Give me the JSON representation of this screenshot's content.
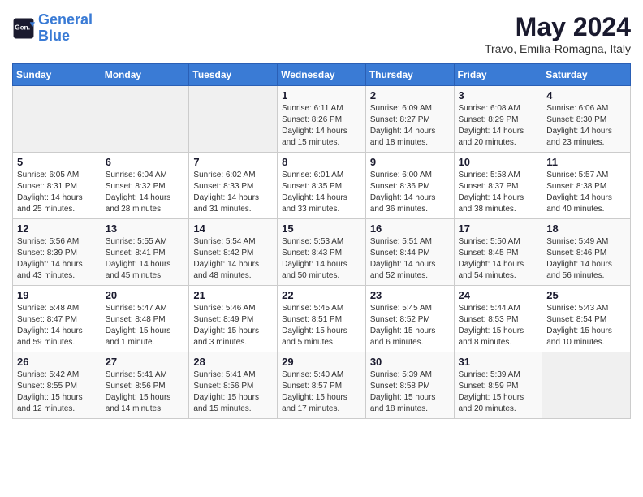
{
  "logo": {
    "line1": "General",
    "line2": "Blue"
  },
  "title": "May 2024",
  "subtitle": "Travo, Emilia-Romagna, Italy",
  "days_of_week": [
    "Sunday",
    "Monday",
    "Tuesday",
    "Wednesday",
    "Thursday",
    "Friday",
    "Saturday"
  ],
  "weeks": [
    [
      {
        "day": "",
        "info": ""
      },
      {
        "day": "",
        "info": ""
      },
      {
        "day": "",
        "info": ""
      },
      {
        "day": "1",
        "info": "Sunrise: 6:11 AM\nSunset: 8:26 PM\nDaylight: 14 hours and 15 minutes."
      },
      {
        "day": "2",
        "info": "Sunrise: 6:09 AM\nSunset: 8:27 PM\nDaylight: 14 hours and 18 minutes."
      },
      {
        "day": "3",
        "info": "Sunrise: 6:08 AM\nSunset: 8:29 PM\nDaylight: 14 hours and 20 minutes."
      },
      {
        "day": "4",
        "info": "Sunrise: 6:06 AM\nSunset: 8:30 PM\nDaylight: 14 hours and 23 minutes."
      }
    ],
    [
      {
        "day": "5",
        "info": "Sunrise: 6:05 AM\nSunset: 8:31 PM\nDaylight: 14 hours and 25 minutes."
      },
      {
        "day": "6",
        "info": "Sunrise: 6:04 AM\nSunset: 8:32 PM\nDaylight: 14 hours and 28 minutes."
      },
      {
        "day": "7",
        "info": "Sunrise: 6:02 AM\nSunset: 8:33 PM\nDaylight: 14 hours and 31 minutes."
      },
      {
        "day": "8",
        "info": "Sunrise: 6:01 AM\nSunset: 8:35 PM\nDaylight: 14 hours and 33 minutes."
      },
      {
        "day": "9",
        "info": "Sunrise: 6:00 AM\nSunset: 8:36 PM\nDaylight: 14 hours and 36 minutes."
      },
      {
        "day": "10",
        "info": "Sunrise: 5:58 AM\nSunset: 8:37 PM\nDaylight: 14 hours and 38 minutes."
      },
      {
        "day": "11",
        "info": "Sunrise: 5:57 AM\nSunset: 8:38 PM\nDaylight: 14 hours and 40 minutes."
      }
    ],
    [
      {
        "day": "12",
        "info": "Sunrise: 5:56 AM\nSunset: 8:39 PM\nDaylight: 14 hours and 43 minutes."
      },
      {
        "day": "13",
        "info": "Sunrise: 5:55 AM\nSunset: 8:41 PM\nDaylight: 14 hours and 45 minutes."
      },
      {
        "day": "14",
        "info": "Sunrise: 5:54 AM\nSunset: 8:42 PM\nDaylight: 14 hours and 48 minutes."
      },
      {
        "day": "15",
        "info": "Sunrise: 5:53 AM\nSunset: 8:43 PM\nDaylight: 14 hours and 50 minutes."
      },
      {
        "day": "16",
        "info": "Sunrise: 5:51 AM\nSunset: 8:44 PM\nDaylight: 14 hours and 52 minutes."
      },
      {
        "day": "17",
        "info": "Sunrise: 5:50 AM\nSunset: 8:45 PM\nDaylight: 14 hours and 54 minutes."
      },
      {
        "day": "18",
        "info": "Sunrise: 5:49 AM\nSunset: 8:46 PM\nDaylight: 14 hours and 56 minutes."
      }
    ],
    [
      {
        "day": "19",
        "info": "Sunrise: 5:48 AM\nSunset: 8:47 PM\nDaylight: 14 hours and 59 minutes."
      },
      {
        "day": "20",
        "info": "Sunrise: 5:47 AM\nSunset: 8:48 PM\nDaylight: 15 hours and 1 minute."
      },
      {
        "day": "21",
        "info": "Sunrise: 5:46 AM\nSunset: 8:49 PM\nDaylight: 15 hours and 3 minutes."
      },
      {
        "day": "22",
        "info": "Sunrise: 5:45 AM\nSunset: 8:51 PM\nDaylight: 15 hours and 5 minutes."
      },
      {
        "day": "23",
        "info": "Sunrise: 5:45 AM\nSunset: 8:52 PM\nDaylight: 15 hours and 6 minutes."
      },
      {
        "day": "24",
        "info": "Sunrise: 5:44 AM\nSunset: 8:53 PM\nDaylight: 15 hours and 8 minutes."
      },
      {
        "day": "25",
        "info": "Sunrise: 5:43 AM\nSunset: 8:54 PM\nDaylight: 15 hours and 10 minutes."
      }
    ],
    [
      {
        "day": "26",
        "info": "Sunrise: 5:42 AM\nSunset: 8:55 PM\nDaylight: 15 hours and 12 minutes."
      },
      {
        "day": "27",
        "info": "Sunrise: 5:41 AM\nSunset: 8:56 PM\nDaylight: 15 hours and 14 minutes."
      },
      {
        "day": "28",
        "info": "Sunrise: 5:41 AM\nSunset: 8:56 PM\nDaylight: 15 hours and 15 minutes."
      },
      {
        "day": "29",
        "info": "Sunrise: 5:40 AM\nSunset: 8:57 PM\nDaylight: 15 hours and 17 minutes."
      },
      {
        "day": "30",
        "info": "Sunrise: 5:39 AM\nSunset: 8:58 PM\nDaylight: 15 hours and 18 minutes."
      },
      {
        "day": "31",
        "info": "Sunrise: 5:39 AM\nSunset: 8:59 PM\nDaylight: 15 hours and 20 minutes."
      },
      {
        "day": "",
        "info": ""
      }
    ]
  ]
}
